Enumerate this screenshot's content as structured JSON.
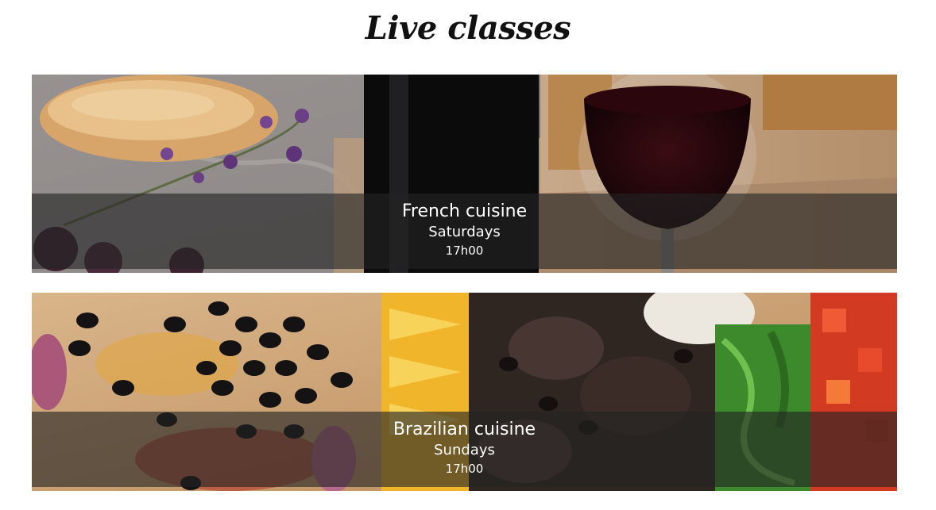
{
  "page": {
    "title": "Live classes"
  },
  "classes": [
    {
      "name": "French cuisine",
      "day": "Saturdays",
      "time": "17h00"
    },
    {
      "name": "Brazilian cuisine",
      "day": "Sundays",
      "time": "17h00"
    }
  ],
  "colors": {
    "caption_overlay": "#232323",
    "caption_text": "#ffffff",
    "title_text": "#111111"
  },
  "icons": {
    "french_photo": "bread-wine-photo",
    "brazil_photo": "feijoada-photo"
  }
}
